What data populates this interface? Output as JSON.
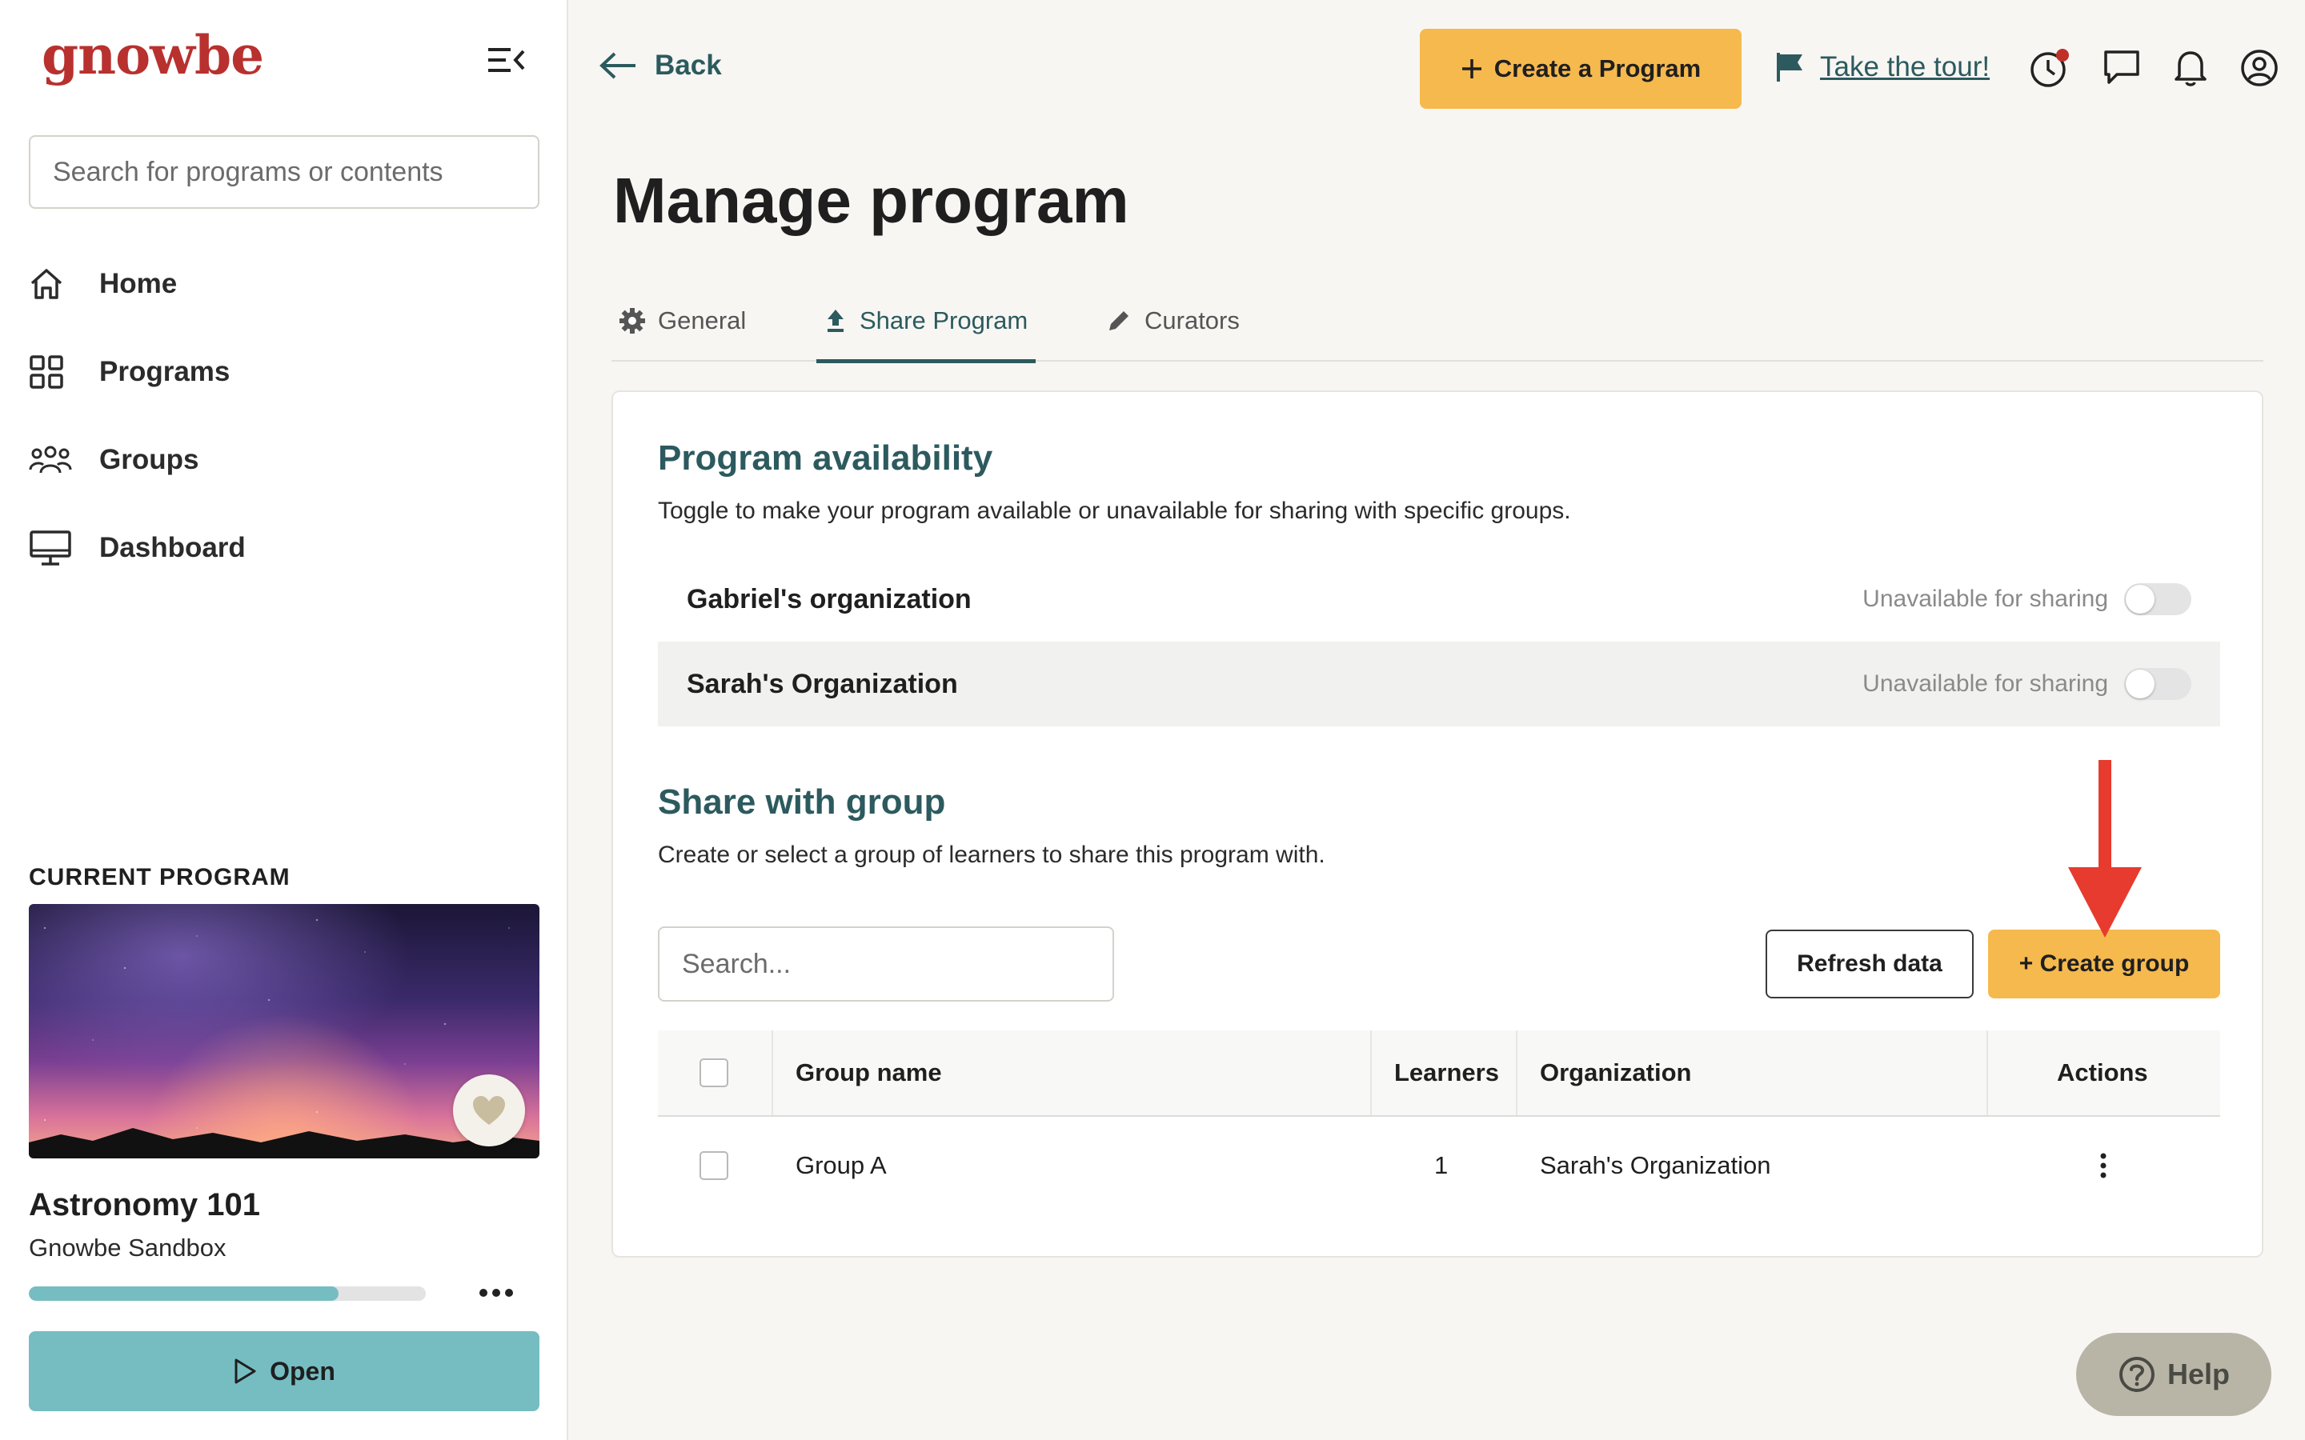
{
  "sidebar": {
    "logo": "gnowbe",
    "search_placeholder": "Search for programs or contents",
    "nav": [
      {
        "label": "Home",
        "icon": "home-icon"
      },
      {
        "label": "Programs",
        "icon": "grid-icon"
      },
      {
        "label": "Groups",
        "icon": "people-icon"
      },
      {
        "label": "Dashboard",
        "icon": "monitor-icon"
      }
    ],
    "current_program": {
      "heading": "CURRENT PROGRAM",
      "title": "Astronomy 101",
      "subtitle": "Gnowbe Sandbox",
      "progress": 0.78,
      "open_label": "Open"
    }
  },
  "topbar": {
    "back_label": "Back",
    "create_program_label": "Create a Program",
    "tour_label": "Take the tour!"
  },
  "page": {
    "title": "Manage program",
    "tabs": [
      {
        "label": "General",
        "icon": "gear-icon",
        "active": false
      },
      {
        "label": "Share Program",
        "icon": "upload-icon",
        "active": true
      },
      {
        "label": "Curators",
        "icon": "pencil-icon",
        "active": false
      }
    ]
  },
  "availability": {
    "title": "Program availability",
    "description": "Toggle to make your program available or unavailable for sharing with specific groups.",
    "orgs": [
      {
        "name": "Gabriel's organization",
        "status": "Unavailable for sharing"
      },
      {
        "name": "Sarah's Organization",
        "status": "Unavailable for sharing"
      }
    ]
  },
  "share": {
    "title": "Share with group",
    "description": "Create or select a group of learners to share this program with.",
    "search_placeholder": "Search...",
    "refresh_label": "Refresh data",
    "create_group_label": "+ Create group",
    "columns": {
      "name": "Group name",
      "learners": "Learners",
      "organization": "Organization",
      "actions": "Actions"
    },
    "rows": [
      {
        "name": "Group A",
        "learners": "1",
        "organization": "Sarah's Organization"
      }
    ]
  },
  "help_label": "Help",
  "colors": {
    "brand": "#b8312f",
    "accent": "#f6b94d",
    "teal": "#2c5a5e",
    "open_button": "#76bdc2",
    "annotation": "#e63b2e"
  }
}
